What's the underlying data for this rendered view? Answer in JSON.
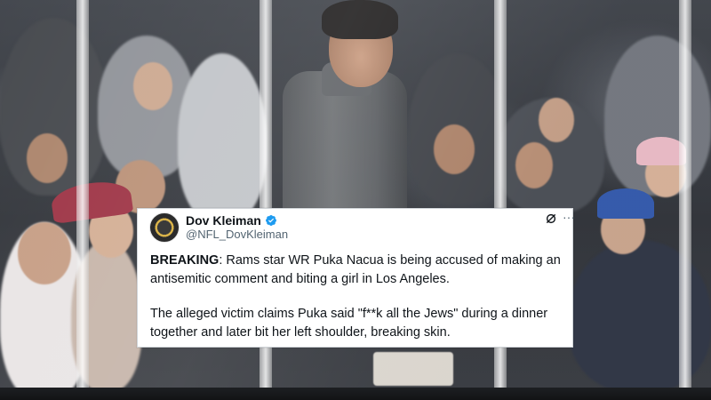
{
  "tweet": {
    "author": {
      "display_name": "Dov Kleiman",
      "handle": "@NFL_DovKleiman",
      "verified": true,
      "avatar_icon": "profile-avatar"
    },
    "icons": {
      "grok": "grok-icon",
      "more": "more-options-icon"
    },
    "body": {
      "lead": "BREAKING",
      "lead_rest": ": Rams star WR Puka Nacua is being accused of making an antisemitic comment and biting a girl in Los Angeles.",
      "paragraph2": "The alleged victim claims Puka said \"f**k all the Jews\" during a dinner together and later bit her left shoulder, breaking skin."
    }
  },
  "colors": {
    "verified_blue": "#1d9bf0",
    "text_primary": "#0f1419",
    "text_secondary": "#536471"
  }
}
